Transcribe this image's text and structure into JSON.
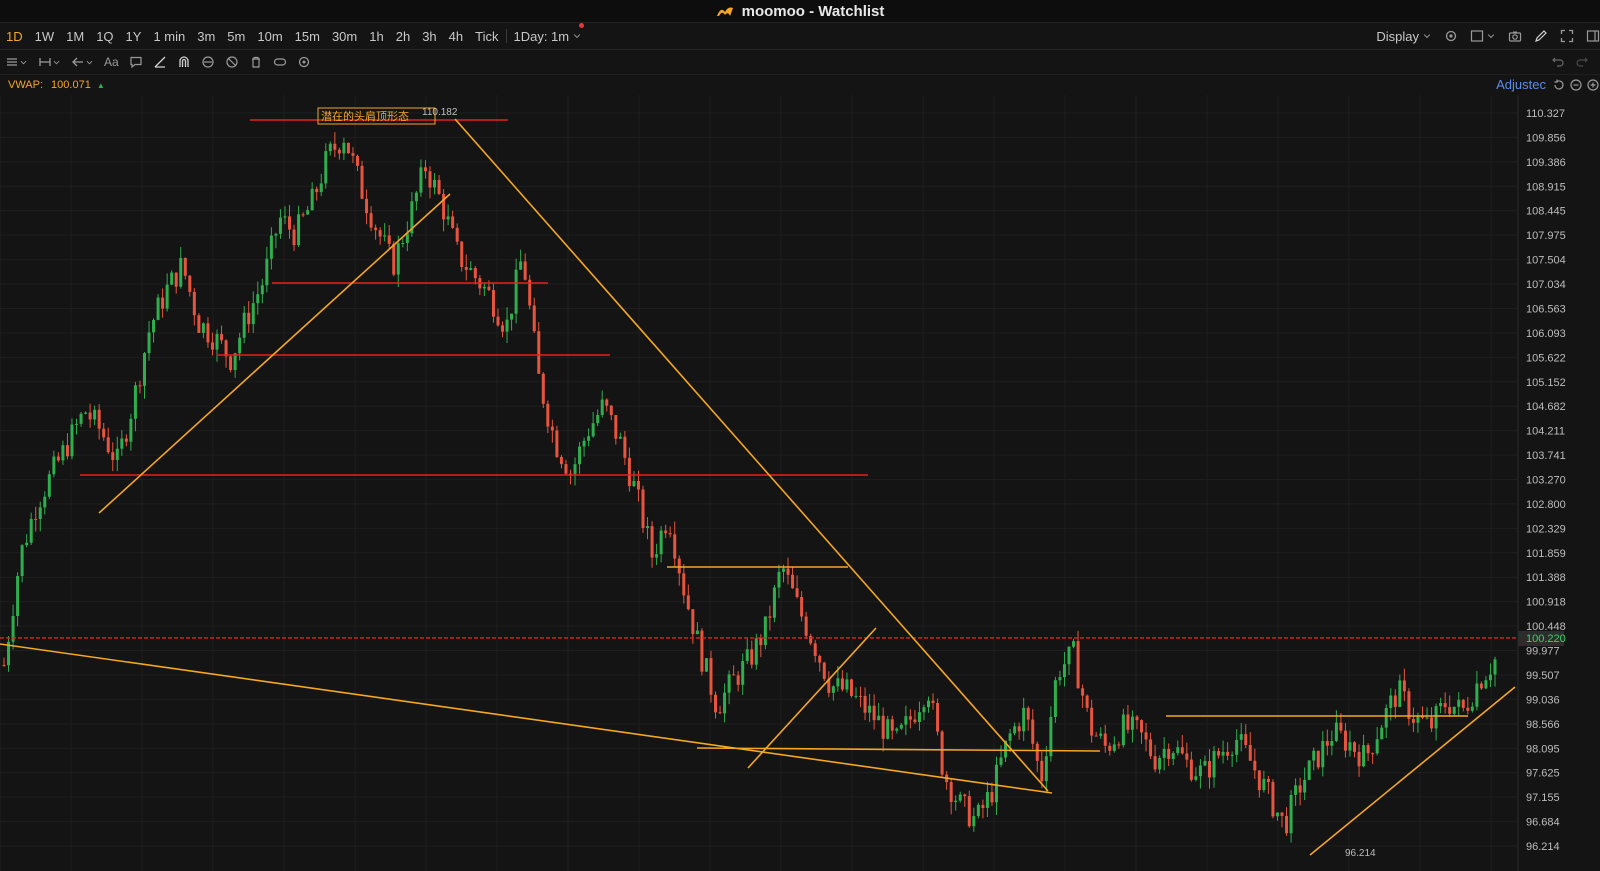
{
  "window": {
    "title": "moomoo - Watchlist"
  },
  "periods": [
    "1D",
    "1W",
    "1M",
    "1Q",
    "1Y",
    "1 min",
    "3m",
    "5m",
    "10m",
    "15m",
    "30m",
    "1h",
    "2h",
    "3h",
    "4h",
    "Tick"
  ],
  "period_active": "1D",
  "period_mode": "1Day: 1m",
  "display_label": "Display",
  "toolbar": {
    "font_tool": "Aa"
  },
  "indicator": {
    "name": "VWAP:",
    "value": "100.071"
  },
  "adjust_label": "Adjustec",
  "colors": {
    "accent": "#f5a623",
    "up": "#2fae4f",
    "down": "#e8553e",
    "hline": "#e3221e",
    "trend": "#f5a623",
    "price_tag": "#2d2d2d"
  },
  "icons": [
    "logo-icon",
    "chevron-down-icon",
    "gear-icon",
    "layout-icon",
    "camera-icon",
    "pen-icon",
    "fullscreen-icon",
    "sidebar-icon",
    "menu-icon",
    "ruler-icon",
    "back-arrow-icon",
    "comment-icon",
    "line-tool-icon",
    "magnet-icon",
    "lock-icon",
    "hide-icon",
    "trash-icon",
    "visibility-icon",
    "settings-icon",
    "undo-icon",
    "redo-icon",
    "reset-icon",
    "minus-icon",
    "plus-icon"
  ],
  "chart_data": {
    "type": "candlestick",
    "y_ticks": [
      "110.327",
      "109.856",
      "109.386",
      "108.915",
      "108.445",
      "107.975",
      "107.504",
      "107.034",
      "106.563",
      "106.093",
      "105.622",
      "105.152",
      "104.682",
      "104.211",
      "103.741",
      "103.270",
      "102.800",
      "102.329",
      "101.859",
      "101.388",
      "100.918",
      "100.448",
      "99.977",
      "99.507",
      "99.036",
      "98.566",
      "98.095",
      "97.625",
      "97.155",
      "96.684",
      "96.214"
    ],
    "ylim": [
      96.214,
      110.327
    ],
    "current_price": "100.220",
    "current_price_value": 100.22,
    "high_label": "110.182",
    "high_value": 110.182,
    "low_label": "96.214",
    "pattern_label": "潜在的头肩顶形态",
    "price_path": [
      99.7,
      101.8,
      102.8,
      103.4,
      104.0,
      104.6,
      104.2,
      103.6,
      104.8,
      106.2,
      106.9,
      107.4,
      106.3,
      106.0,
      105.6,
      106.4,
      107.1,
      108.3,
      108.0,
      108.6,
      109.5,
      109.9,
      108.9,
      108.1,
      107.4,
      108.3,
      109.3,
      108.6,
      107.6,
      107.2,
      106.8,
      106.2,
      107.6,
      105.2,
      104.0,
      103.4,
      104.2,
      104.7,
      104.0,
      103.0,
      101.8,
      102.6,
      101.1,
      99.9,
      98.9,
      99.4,
      99.8,
      100.4,
      101.6,
      100.8,
      100.1,
      99.3,
      99.2,
      98.9,
      98.6,
      98.2,
      98.7,
      99.3,
      97.6,
      97.0,
      96.7,
      97.3,
      98.3,
      98.8,
      97.5,
      99.6,
      99.9,
      98.5,
      98.1,
      98.5,
      98.4,
      97.9,
      98.2,
      97.8,
      97.6,
      98.0,
      98.3,
      97.8,
      97.2,
      96.6,
      97.4,
      97.9,
      98.4,
      98.2,
      97.9,
      98.6,
      99.2,
      98.7,
      98.5,
      99.0,
      98.8,
      99.4,
      99.8
    ]
  }
}
